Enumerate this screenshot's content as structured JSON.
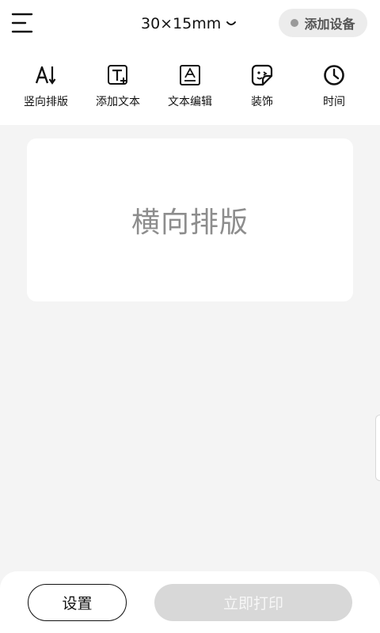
{
  "header": {
    "label_size": "30×15mm",
    "device_button": "添加设备",
    "menu_icon": "menu-icon"
  },
  "toolbar": {
    "items": [
      {
        "label": "竖向排版",
        "icon": "vertical-layout-icon"
      },
      {
        "label": "添加文本",
        "icon": "add-text-icon"
      },
      {
        "label": "文本编辑",
        "icon": "text-edit-icon"
      },
      {
        "label": "装饰",
        "icon": "sticker-icon"
      },
      {
        "label": "时间",
        "icon": "clock-icon"
      }
    ]
  },
  "canvas": {
    "text": "横向排版"
  },
  "bottom": {
    "settings_label": "设置",
    "print_label": "立即打印"
  },
  "colors": {
    "background": "#f4f4f4",
    "card": "#ffffff",
    "print_disabled": "#d8d8d8",
    "placeholder_text": "#8d8d8d"
  }
}
